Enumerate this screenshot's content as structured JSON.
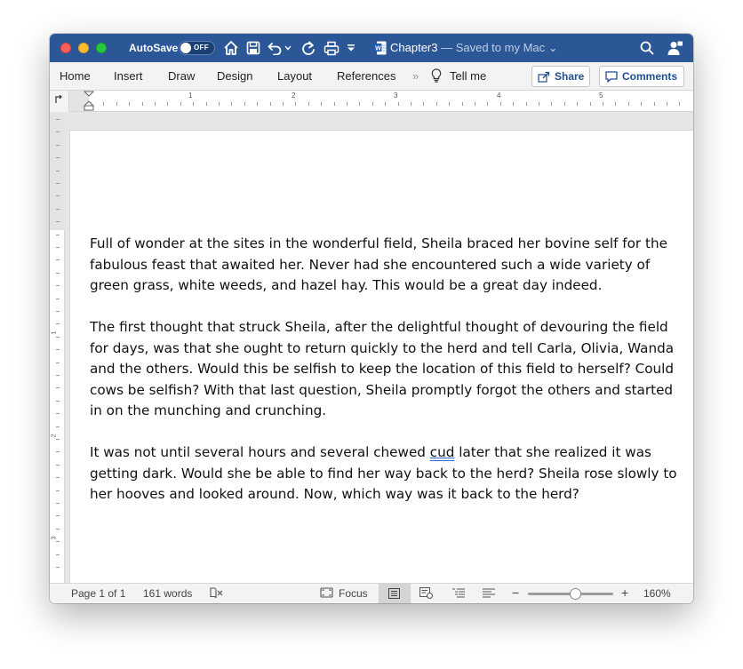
{
  "titlebar": {
    "autosave_label": "AutoSave",
    "autosave_state": "OFF",
    "doc_name": "Chapter3",
    "doc_status": " — Saved to my Mac ⌄"
  },
  "ribbon": {
    "tabs": [
      "Home",
      "Insert",
      "Draw",
      "Design",
      "Layout",
      "References"
    ],
    "more_glyph": "»",
    "tell_me": "Tell me",
    "share": "Share",
    "comments": "Comments"
  },
  "ruler": {
    "numbers": [
      "1",
      "2",
      "3",
      "4",
      "5"
    ],
    "vertical_numbers": [
      "1",
      "2",
      "3"
    ]
  },
  "document": {
    "paragraphs": [
      {
        "text": "Full of wonder at the sites in the wonderful field, Sheila braced her bovine self for the fabulous feast that awaited her. Never had she encountered such a wide variety of green grass, white weeds, and hazel hay. This would be a great day indeed."
      },
      {
        "text": "The first thought that struck Sheila, after the delightful thought of devouring the field for days, was that she ought to return quickly to the herd and tell Carla, Olivia, Wanda and the others. Would this be selfish to keep the location of this field to herself? Could cows be selfish? With that last question, Sheila promptly forgot the others and started in on the munching and crunching."
      },
      {
        "before": "It was not until several hours and several chewed ",
        "flagged": "cud",
        "after": " later that she realized it was getting dark. Would she be able to find her way back to the herd? Sheila rose slowly to her hooves and looked around. Now, which way was it back to the herd?"
      }
    ]
  },
  "statusbar": {
    "page": "Page 1 of 1",
    "words": "161 words",
    "focus": "Focus",
    "zoom_minus": "−",
    "zoom_plus": "+",
    "zoom": "160%",
    "zoom_level_fraction": 0.55
  },
  "colors": {
    "titlebar": "#2b5797",
    "accent": "#1f4f8f",
    "spell_underline": "#2a6ad4"
  }
}
